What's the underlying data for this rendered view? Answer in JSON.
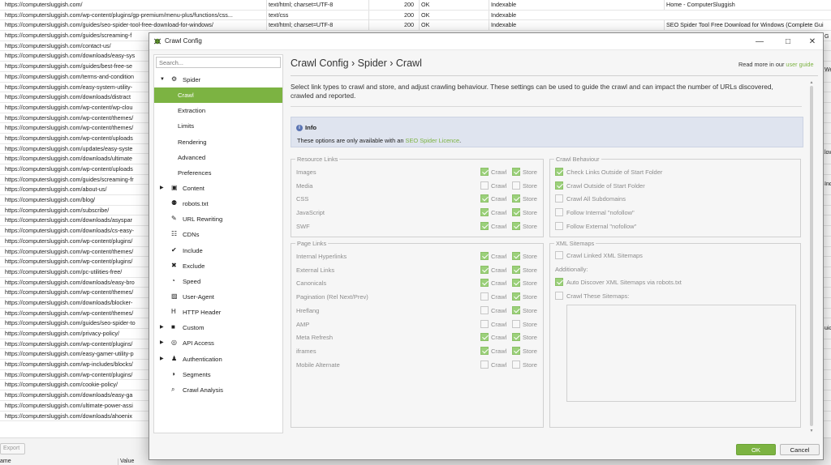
{
  "background": {
    "rows": [
      {
        "url": "https://computersluggish.com/",
        "content_type": "text/html; charset=UTF-8",
        "code": "200",
        "status": "OK",
        "indexability": "Indexable",
        "title": "Home - ComputerSluggish"
      },
      {
        "url": "https://computersluggish.com/wp-content/plugins/gp-premium/menu-plus/functions/css...",
        "content_type": "text/css",
        "code": "200",
        "status": "OK",
        "indexability": "Indexable",
        "title": ""
      },
      {
        "url": "https://computersluggish.com/guides/seo-spider-tool-free-download-for-windows/",
        "content_type": "text/html; charset=UTF-8",
        "code": "200",
        "status": "OK",
        "indexability": "Indexable",
        "title": "SEO Spider Tool Free Download for Windows (Complete Gui"
      },
      {
        "url": "https://computersluggish.com/guides/screaming-f"
      },
      {
        "url": "https://computersluggish.com/contact-us/"
      },
      {
        "url": "https://computersluggish.com/downloads/easy-sys"
      },
      {
        "url": "https://computersluggish.com/guides/best-free-se"
      },
      {
        "url": "https://computersluggish.com/terms-and-condition"
      },
      {
        "url": "https://computersluggish.com/easy-system-utility-"
      },
      {
        "url": "https://computersluggish.com/downloads/distract"
      },
      {
        "url": "https://computersluggish.com/wp-content/wp-clou"
      },
      {
        "url": "https://computersluggish.com/wp-content/themes/"
      },
      {
        "url": "https://computersluggish.com/wp-content/themes/"
      },
      {
        "url": "https://computersluggish.com/wp-content/uploads"
      },
      {
        "url": "https://computersluggish.com/updates/easy-syste"
      },
      {
        "url": "https://computersluggish.com/downloads/ultimate"
      },
      {
        "url": "https://computersluggish.com/wp-content/uploads"
      },
      {
        "url": "https://computersluggish.com/guides/screaming-fr"
      },
      {
        "url": "https://computersluggish.com/about-us/"
      },
      {
        "url": "https://computersluggish.com/blog/"
      },
      {
        "url": "https://computersluggish.com/subscribe/"
      },
      {
        "url": "https://computersluggish.com/downloads/asyspar"
      },
      {
        "url": "https://computersluggish.com/downloads/cs-easy-"
      },
      {
        "url": "https://computersluggish.com/wp-content/plugins/"
      },
      {
        "url": "https://computersluggish.com/wp-content/themes/"
      },
      {
        "url": "https://computersluggish.com/wp-content/plugins/"
      },
      {
        "url": "https://computersluggish.com/pc-utilities-free/"
      },
      {
        "url": "https://computersluggish.com/downloads/easy-bro"
      },
      {
        "url": "https://computersluggish.com/wp-content/themes/"
      },
      {
        "url": "https://computersluggish.com/downloads/blocker-"
      },
      {
        "url": "https://computersluggish.com/wp-content/themes/"
      },
      {
        "url": "https://computersluggish.com/guides/seo-spider-to"
      },
      {
        "url": "https://computersluggish.com/privacy-policy/"
      },
      {
        "url": "https://computersluggish.com/wp-content/plugins/"
      },
      {
        "url": "https://computersluggish.com/easy-gamer-utility-p"
      },
      {
        "url": "https://computersluggish.com/wp-includes/blocks/"
      },
      {
        "url": "https://computersluggish.com/wp-content/plugins/"
      },
      {
        "url": "https://computersluggish.com/cookie-policy/"
      },
      {
        "url": "https://computersluggish.com/downloads/easy-ga"
      },
      {
        "url": "https://computersluggish.com/ultimate-power-assi"
      },
      {
        "url": "https://computersluggish.com/downloads/ahoenix"
      }
    ],
    "right_fragments": [
      "G",
      "We",
      "low",
      "Ind",
      "uid"
    ],
    "export_label": "Export",
    "bottom_headers": [
      "ame",
      "Value"
    ]
  },
  "dialog": {
    "title": "Crawl Config",
    "search_placeholder": "Search...",
    "breadcrumb": "Crawl Config › Spider › Crawl",
    "read_more_prefix": "Read more in our",
    "read_more_link": "user guide",
    "description": "Select link types to crawl and store, and adjust crawling behaviour. These settings can be used to guide the crawl and can impact the number of URLs discovered, crawled and reported.",
    "info": {
      "title": "Info",
      "text_prefix": "These options are only available with an",
      "link": "SEO Spider Licence",
      "text_suffix": "."
    },
    "accent_color": "#7cb342",
    "ok_label": "OK",
    "cancel_label": "Cancel"
  },
  "sidebar": {
    "items": [
      {
        "label": "Spider",
        "level": 0,
        "arrow": "▼",
        "icon": "gear-icon"
      },
      {
        "label": "Crawl",
        "level": 1,
        "active": true
      },
      {
        "label": "Extraction",
        "level": 1
      },
      {
        "label": "Limits",
        "level": 1
      },
      {
        "label": "Rendering",
        "level": 1
      },
      {
        "label": "Advanced",
        "level": 1
      },
      {
        "label": "Preferences",
        "level": 1
      },
      {
        "label": "Content",
        "level": 0,
        "arrow": "▶",
        "icon": "content-icon"
      },
      {
        "label": "robots.txt",
        "level": 0,
        "icon": "robot-icon"
      },
      {
        "label": "URL Rewriting",
        "level": 0,
        "icon": "edit-icon"
      },
      {
        "label": "CDNs",
        "level": 0,
        "icon": "network-icon"
      },
      {
        "label": "Include",
        "level": 0,
        "icon": "check-circle-icon"
      },
      {
        "label": "Exclude",
        "level": 0,
        "icon": "x-circle-icon"
      },
      {
        "label": "Speed",
        "level": 0,
        "icon": "speed-icon"
      },
      {
        "label": "User-Agent",
        "level": 0,
        "icon": "user-agent-icon"
      },
      {
        "label": "HTTP Header",
        "level": 0,
        "icon": "header-icon"
      },
      {
        "label": "Custom",
        "level": 0,
        "arrow": "▶",
        "icon": "custom-icon"
      },
      {
        "label": "API Access",
        "level": 0,
        "arrow": "▶",
        "icon": "globe-icon"
      },
      {
        "label": "Authentication",
        "level": 0,
        "arrow": "▶",
        "icon": "users-icon"
      },
      {
        "label": "Segments",
        "level": 0,
        "icon": "segments-icon"
      },
      {
        "label": "Crawl Analysis",
        "level": 0,
        "icon": "search-icon"
      }
    ]
  },
  "resource_links": {
    "title": "Resource Links",
    "crawl_label": "Crawl",
    "store_label": "Store",
    "rows": [
      {
        "label": "Images",
        "crawl": true,
        "store": true
      },
      {
        "label": "Media",
        "crawl": false,
        "store": false
      },
      {
        "label": "CSS",
        "crawl": true,
        "store": true
      },
      {
        "label": "JavaScript",
        "crawl": true,
        "store": true
      },
      {
        "label": "SWF",
        "crawl": true,
        "store": true
      }
    ]
  },
  "page_links": {
    "title": "Page Links",
    "crawl_label": "Crawl",
    "store_label": "Store",
    "rows": [
      {
        "label": "Internal Hyperlinks",
        "crawl": true,
        "store": true
      },
      {
        "label": "External Links",
        "crawl": true,
        "store": true
      },
      {
        "label": "Canonicals",
        "crawl": true,
        "store": true
      },
      {
        "label": "Pagination (Rel Next/Prev)",
        "crawl": false,
        "store": true
      },
      {
        "label": "Hreflang",
        "crawl": false,
        "store": true
      },
      {
        "label": "AMP",
        "crawl": false,
        "store": false
      },
      {
        "label": "Meta Refresh",
        "crawl": true,
        "store": true
      },
      {
        "label": "iframes",
        "crawl": true,
        "store": true
      },
      {
        "label": "Mobile Alternate",
        "crawl": false,
        "store": false
      }
    ]
  },
  "crawl_behaviour": {
    "title": "Crawl Behaviour",
    "options": [
      {
        "label": "Check Links Outside of Start Folder",
        "checked": true
      },
      {
        "label": "Crawl Outside of Start Folder",
        "checked": true
      },
      {
        "label": "Crawl All Subdomains",
        "checked": false
      },
      {
        "label": "Follow Internal \"nofollow\"",
        "checked": false
      },
      {
        "label": "Follow External \"nofollow\"",
        "checked": false
      }
    ]
  },
  "xml_sitemaps": {
    "title": "XML Sitemaps",
    "crawl_linked": {
      "label": "Crawl Linked XML Sitemaps",
      "checked": false
    },
    "additionally_label": "Additionally:",
    "auto_discover": {
      "label": "Auto Discover XML Sitemaps via robots.txt",
      "checked": true
    },
    "crawl_these": {
      "label": "Crawl These Sitemaps:",
      "checked": false
    }
  }
}
